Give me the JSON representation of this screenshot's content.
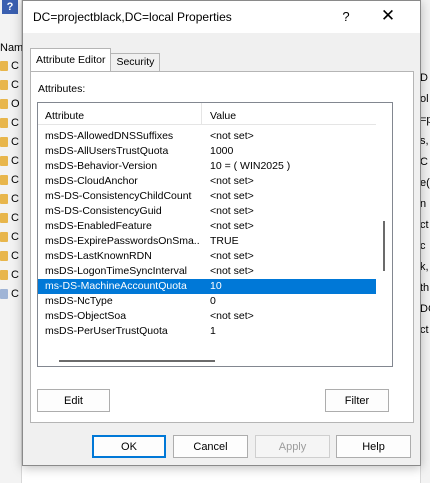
{
  "background_window": {
    "header_text": "Nam",
    "folder_letters": [
      "C",
      "C",
      "O",
      "C",
      "C",
      "C",
      "C",
      "C",
      "C",
      "C",
      "C",
      "C",
      "C"
    ],
    "right_chars": [
      "D",
      "ol",
      "=p",
      "s,",
      "C",
      "e(",
      "n",
      "ct",
      "c",
      "k,",
      "th",
      "DC",
      "ct"
    ]
  },
  "dialog": {
    "title": "DC=projectblack,DC=local Properties",
    "help_label": "?",
    "close_label": "✕",
    "tabs": [
      {
        "label": "Attribute Editor",
        "active": true
      },
      {
        "label": "Security",
        "active": false
      }
    ],
    "attributes_label": "Attributes:",
    "columns": {
      "attribute": "Attribute",
      "value": "Value"
    },
    "rows": [
      {
        "attribute": "msDS-AllowedDNSSuffixes",
        "value": "<not set>"
      },
      {
        "attribute": "msDS-AllUsersTrustQuota",
        "value": "1000"
      },
      {
        "attribute": "msDS-Behavior-Version",
        "value": "10 = ( WIN2025 )"
      },
      {
        "attribute": "msDS-CloudAnchor",
        "value": "<not set>"
      },
      {
        "attribute": "mS-DS-ConsistencyChildCount",
        "value": "<not set>"
      },
      {
        "attribute": "mS-DS-ConsistencyGuid",
        "value": "<not set>"
      },
      {
        "attribute": "msDS-EnabledFeature",
        "value": "<not set>"
      },
      {
        "attribute": "msDS-ExpirePasswordsOnSma...",
        "value": "TRUE"
      },
      {
        "attribute": "msDS-LastKnownRDN",
        "value": "<not set>"
      },
      {
        "attribute": "msDS-LogonTimeSyncInterval",
        "value": "<not set>"
      },
      {
        "attribute": "ms-DS-MachineAccountQuota",
        "value": "10",
        "selected": true
      },
      {
        "attribute": "msDS-NcType",
        "value": "0"
      },
      {
        "attribute": "msDS-ObjectSoa",
        "value": "<not set>"
      },
      {
        "attribute": "msDS-PerUserTrustQuota",
        "value": "1"
      }
    ],
    "edit_button": "Edit",
    "filter_button": "Filter",
    "ok_button": "OK",
    "cancel_button": "Cancel",
    "apply_button": "Apply",
    "help_button": "Help"
  },
  "colors": {
    "selection": "#0078d7",
    "dialog_bg": "#f0f0f0",
    "folder": "#e8b64c"
  }
}
